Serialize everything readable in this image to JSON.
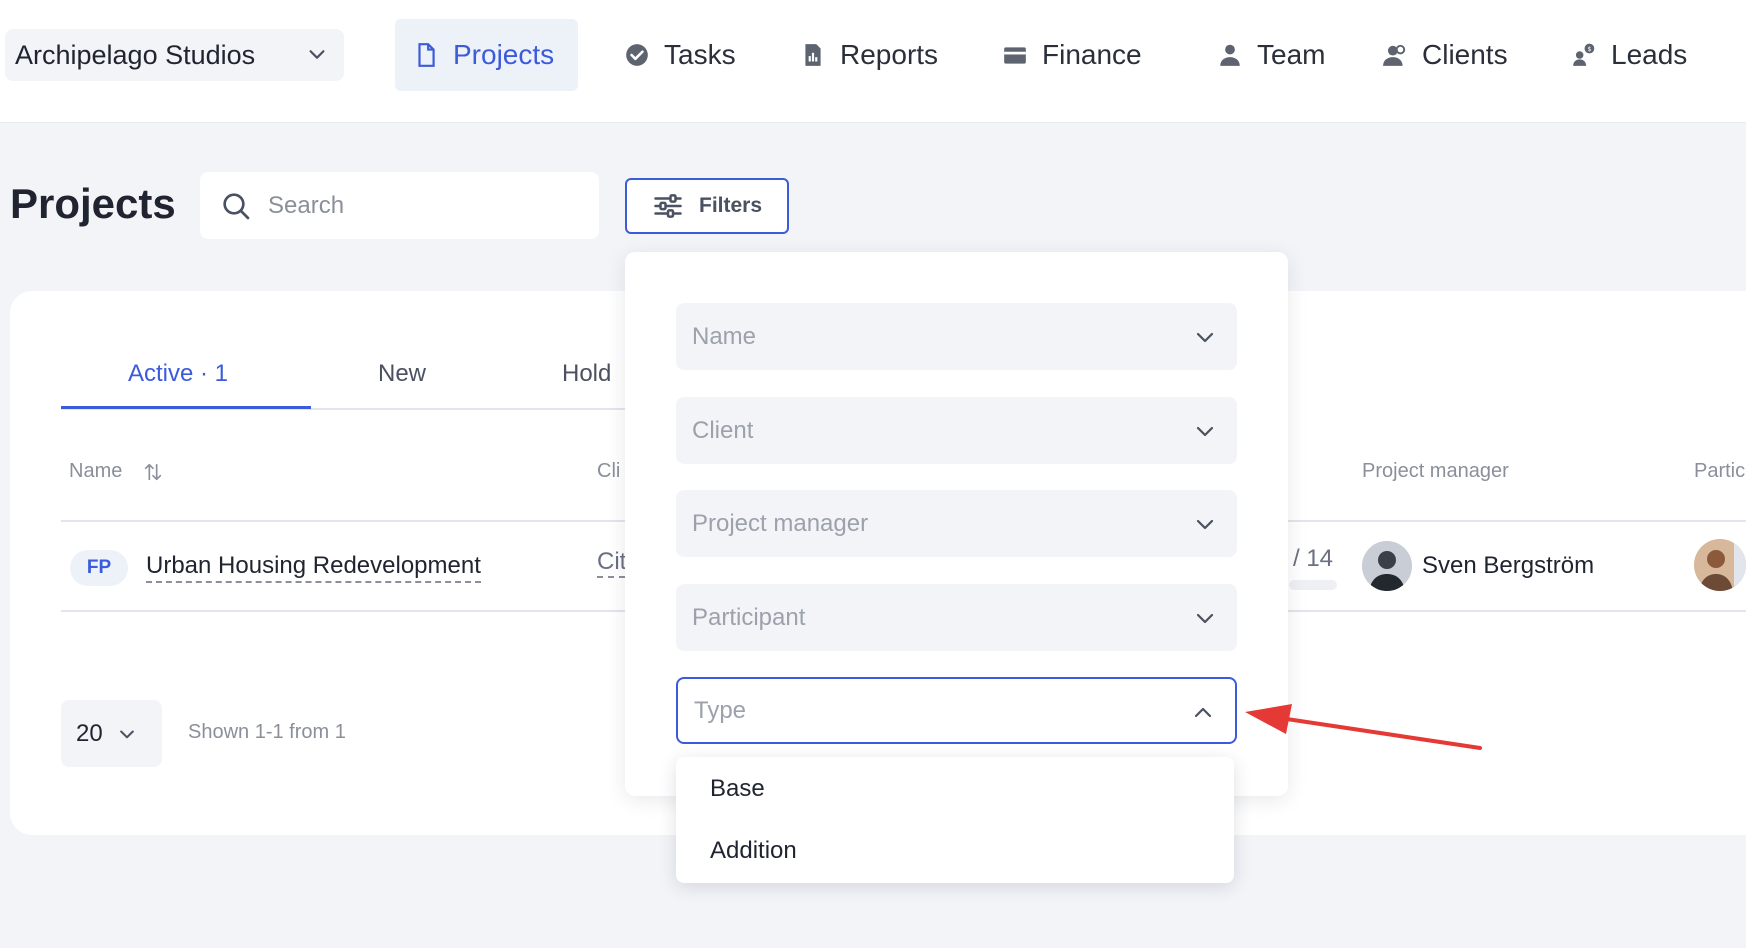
{
  "org": {
    "name": "Archipelago Studios"
  },
  "nav": {
    "items": [
      {
        "label": "Projects",
        "icon": "file-icon",
        "active": true
      },
      {
        "label": "Tasks",
        "icon": "check-circle-icon"
      },
      {
        "label": "Reports",
        "icon": "report-icon"
      },
      {
        "label": "Finance",
        "icon": "wallet-icon"
      },
      {
        "label": "Team",
        "icon": "user-icon"
      },
      {
        "label": "Clients",
        "icon": "users-icon"
      },
      {
        "label": "Leads",
        "icon": "leads-icon"
      }
    ]
  },
  "page": {
    "title": "Projects"
  },
  "search": {
    "placeholder": "Search",
    "value": ""
  },
  "filters": {
    "label": "Filters"
  },
  "tabs": [
    {
      "label": "Active · 1",
      "active": true
    },
    {
      "label": "New"
    },
    {
      "label": "Hold"
    }
  ],
  "table": {
    "headers": {
      "name": "Name",
      "client": "Cli",
      "project_manager": "Project manager",
      "participants": "Partic"
    },
    "rows": [
      {
        "badge": "FP",
        "name": "Urban Housing Redevelopment",
        "client": "Cit",
        "progress": "/ 14",
        "project_manager": "Sven Bergström"
      }
    ]
  },
  "pagination": {
    "page_size": "20",
    "shown": "Shown 1-1 from 1"
  },
  "filter_panel": {
    "fields": [
      {
        "placeholder": "Name",
        "open": false
      },
      {
        "placeholder": "Client",
        "open": false
      },
      {
        "placeholder": "Project manager",
        "open": false
      },
      {
        "placeholder": "Participant",
        "open": false
      },
      {
        "placeholder": "Type",
        "open": true
      }
    ],
    "type_options": [
      "Base",
      "Addition"
    ]
  },
  "colors": {
    "accent": "#3b5bdb",
    "annotation_arrow": "#e53935",
    "background": "#f2f4f8"
  }
}
